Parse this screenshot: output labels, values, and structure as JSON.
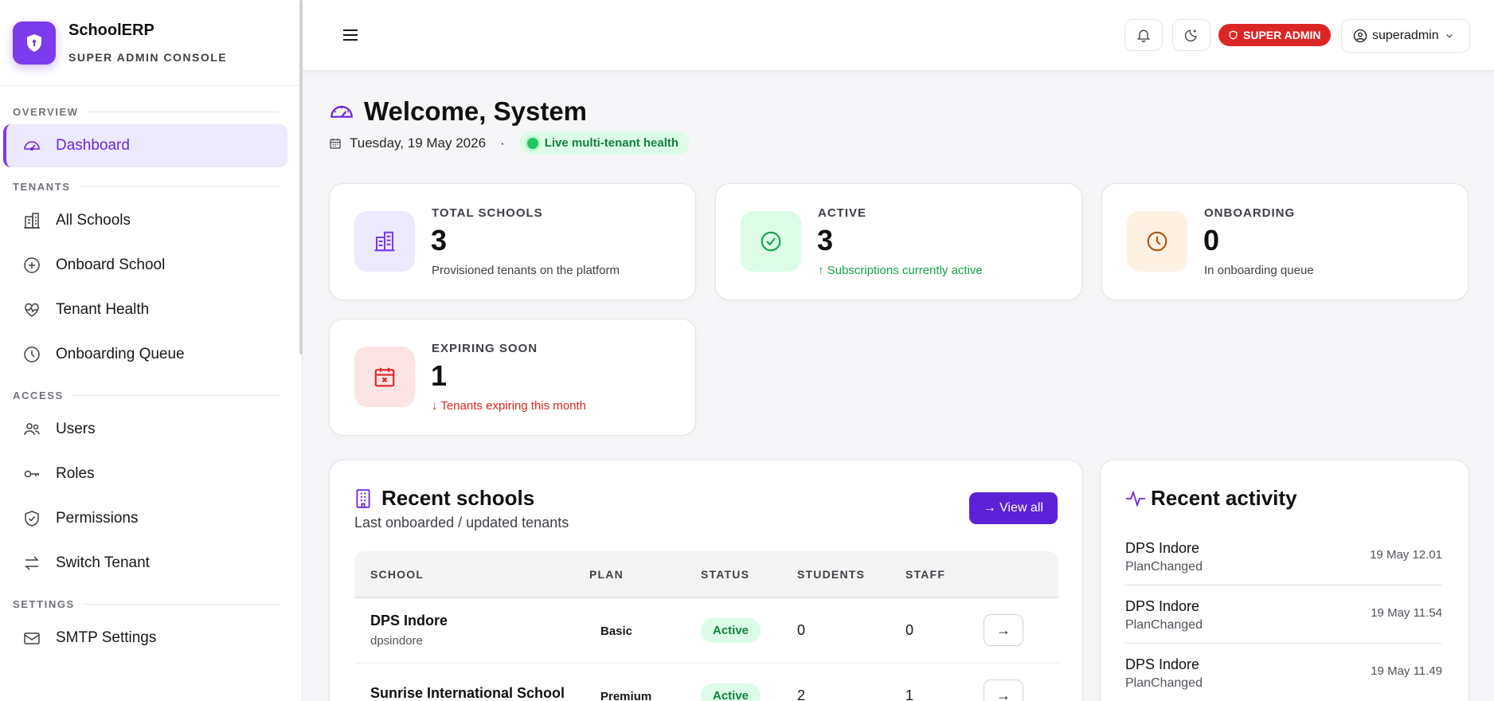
{
  "brand": {
    "title": "SchoolERP",
    "subtitle": "SUPER ADMIN CONSOLE"
  },
  "sidebar": {
    "sections": [
      {
        "label": "OVERVIEW",
        "items": [
          {
            "label": "Dashboard",
            "icon": "gauge-icon",
            "active": true
          }
        ]
      },
      {
        "label": "TENANTS",
        "items": [
          {
            "label": "All Schools",
            "icon": "building-icon"
          },
          {
            "label": "Onboard School",
            "icon": "plus-circle-icon"
          },
          {
            "label": "Tenant Health",
            "icon": "heart-pulse-icon"
          },
          {
            "label": "Onboarding Queue",
            "icon": "clock-icon"
          }
        ]
      },
      {
        "label": "ACCESS",
        "items": [
          {
            "label": "Users",
            "icon": "users-icon"
          },
          {
            "label": "Roles",
            "icon": "key-icon"
          },
          {
            "label": "Permissions",
            "icon": "shield-check-icon"
          },
          {
            "label": "Switch Tenant",
            "icon": "switch-arrows-icon"
          }
        ]
      },
      {
        "label": "SETTINGS",
        "items": [
          {
            "label": "SMTP Settings",
            "icon": "mail-icon"
          }
        ]
      }
    ]
  },
  "topbar": {
    "role_badge": "SUPER ADMIN",
    "username": "superadmin"
  },
  "welcome": {
    "title": "Welcome, System",
    "date": "Tuesday, 19 May 2026",
    "separator": "·",
    "live_label": "Live multi-tenant health"
  },
  "stats": {
    "total": {
      "label": "TOTAL SCHOOLS",
      "value": "3",
      "desc": "Provisioned tenants on the platform"
    },
    "active": {
      "label": "ACTIVE",
      "value": "3",
      "desc": "↑ Subscriptions currently active"
    },
    "onboarding": {
      "label": "ONBOARDING",
      "value": "0",
      "desc": "In onboarding queue"
    },
    "expiring": {
      "label": "EXPIRING SOON",
      "value": "1",
      "desc": "↓ Tenants expiring this month"
    }
  },
  "recent_schools": {
    "title": "Recent schools",
    "subtitle": "Last onboarded / updated tenants",
    "view_all": "→ View all",
    "columns": [
      "SCHOOL",
      "PLAN",
      "STATUS",
      "STUDENTS",
      "STAFF"
    ],
    "rows": [
      {
        "name": "DPS Indore",
        "slug": "dpsindore",
        "plan": "Basic",
        "status": "Active",
        "students": "0",
        "staff": "0",
        "action": "→"
      },
      {
        "name": "Sunrise International School",
        "slug": "",
        "plan": "Premium",
        "status": "Active",
        "students": "2",
        "staff": "1",
        "action": "→"
      }
    ]
  },
  "recent_activity": {
    "title": "Recent activity",
    "items": [
      {
        "title": "DPS Indore",
        "sub": "PlanChanged",
        "time": "19 May 12.01"
      },
      {
        "title": "DPS Indore",
        "sub": "PlanChanged",
        "time": "19 May 11.54"
      },
      {
        "title": "DPS Indore",
        "sub": "PlanChanged",
        "time": "19 May 11.49"
      }
    ]
  },
  "colors": {
    "accent": "#7c3aed",
    "danger": "#dc2626",
    "success": "#16a34a"
  }
}
